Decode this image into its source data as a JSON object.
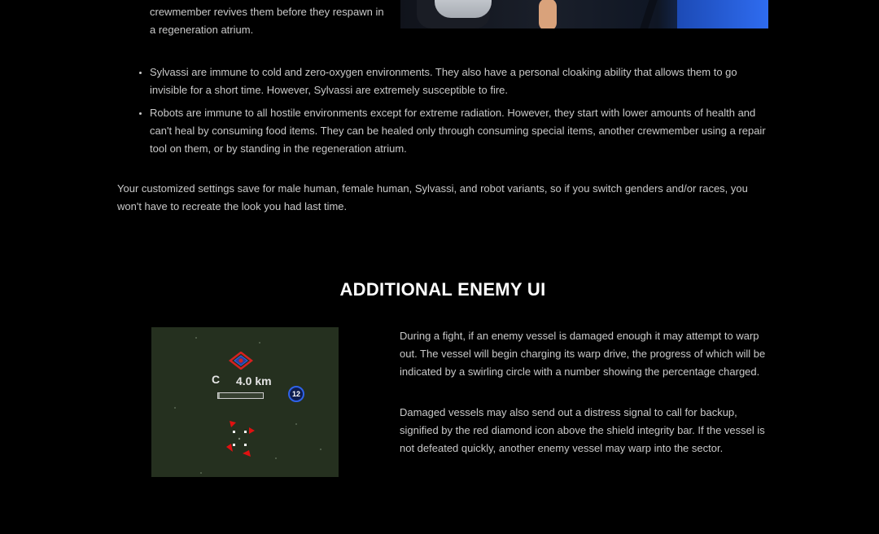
{
  "intro": {
    "text": "crewmember revives them before they respawn in a regeneration atrium."
  },
  "bullets": [
    {
      "text": "Sylvassi are immune to cold and zero-oxygen environments. They also have a personal cloaking ability that allows them to go invisible for a short time. However, Sylvassi are extremely susceptible to fire."
    },
    {
      "text": "Robots are immune to all hostile environments except for extreme radiation. However, they start with lower amounts of health and can't heal by consuming food items. They can be healed only through consuming special items, another crewmember using a repair tool on them, or by standing in the regeneration atrium."
    }
  ],
  "settings_paragraph": "Your customized settings save for male human, female human, Sylvassi, and robot variants, so if you switch genders and/or races, you won't have to recreate the look you had last time.",
  "section": {
    "title": "ADDITIONAL ENEMY UI",
    "screenshot": {
      "ship_letter": "C",
      "distance": "4.0 km",
      "warp_percent": "12",
      "shield_fraction": 0.03,
      "colors": {
        "background": "#25301f",
        "distress": "#d62020",
        "warp": "#2f62e8",
        "reticle": "#e01010"
      }
    },
    "paragraphs": [
      "During a fight, if an enemy vessel is damaged enough it may attempt to warp out. The vessel will begin charging its warp drive, the progress of which will be indicated by a swirling circle with a number showing the percentage charged.",
      "Damaged vessels may also send out a distress signal to call for backup, signified by the red diamond icon above the shield integrity bar. If the vessel is not defeated quickly, another enemy vessel may warp into the sector."
    ]
  }
}
